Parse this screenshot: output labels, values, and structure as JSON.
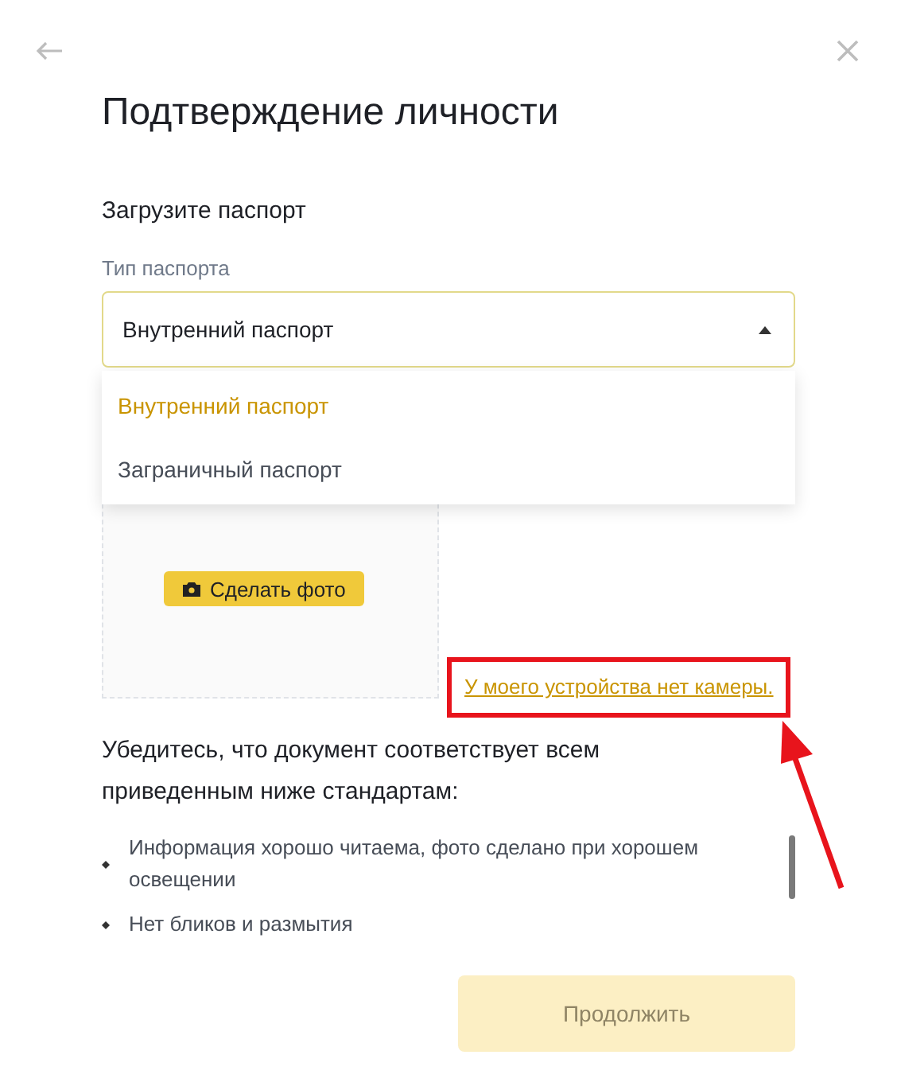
{
  "title": "Подтверждение личности",
  "section": "Загрузите паспорт",
  "passport_type": {
    "label": "Тип паспорта",
    "value": "Внутренний паспорт",
    "expanded": true,
    "options": [
      {
        "label": "Внутренний паспорт",
        "selected": true
      },
      {
        "label": "Заграничный паспорт",
        "selected": false
      }
    ]
  },
  "take_photo_button": "Сделать фото",
  "no_camera_link": "У моего устройства нет камеры.",
  "requirements": {
    "heading": "Убедитесь, что документ соответствует всем приведенным ниже стандартам:",
    "items": [
      "Информация хорошо читаема, фото сделано при хорошем освещении",
      "Нет бликов и размытия"
    ]
  },
  "continue_button": {
    "label": "Продолжить",
    "disabled": true
  }
}
